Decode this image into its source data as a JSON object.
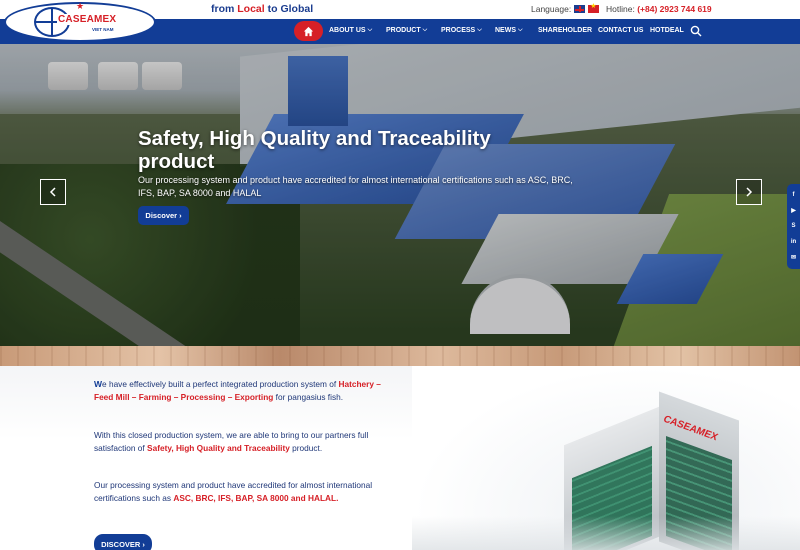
{
  "top": {
    "tagline_from": "from",
    "tagline_local": "Local",
    "tagline_to": "to Global",
    "language_label": "Language:",
    "hotline_label": "Hotline:",
    "hotline_number": "(+84) 2923 744 619"
  },
  "logo": {
    "text": "CASEAMEX",
    "sub": "VIET NAM"
  },
  "nav": {
    "items": [
      {
        "label": "ABOUT US",
        "dropdown": true
      },
      {
        "label": "PRODUCT",
        "dropdown": true
      },
      {
        "label": "PROCESS",
        "dropdown": true
      },
      {
        "label": "NEWS",
        "dropdown": true
      },
      {
        "label": "SHAREHOLDER",
        "dropdown": false
      },
      {
        "label": "CONTACT US",
        "dropdown": false
      },
      {
        "label": "HOTDEAL",
        "dropdown": false
      }
    ]
  },
  "hero": {
    "title": "Safety, High Quality and Traceability product",
    "description": "Our processing system and product have accredited for almost international certifications such as ASC, BRC, IFS, BAP, SA 8000 and HALAL",
    "button": "Discover"
  },
  "social": [
    "f",
    "▶",
    "S",
    "in",
    "✉"
  ],
  "intro": {
    "p1_first": "W",
    "p1_a": "e have effectively built a perfect integrated production system of",
    "p1_red": "Hatchery – Feed Mill – Farming – Processing – Exporting",
    "p1_b": "for pangasius fish.",
    "p2_a": "With this closed production system, we are able to bring to our partners full satisfaction of",
    "p2_red": "Safety, High Quality and Traceability",
    "p2_b": "product.",
    "p3_a": "Our processing system and product have accredited for almost international certifications such as",
    "p3_red": "ASC, BRC, IFS, BAP, SA 8000 and HALAL.",
    "button": "DISCOVER"
  },
  "building_sign": "CASEAMEX",
  "colors": {
    "brand_blue": "#123d96",
    "accent_red": "#d62027"
  }
}
